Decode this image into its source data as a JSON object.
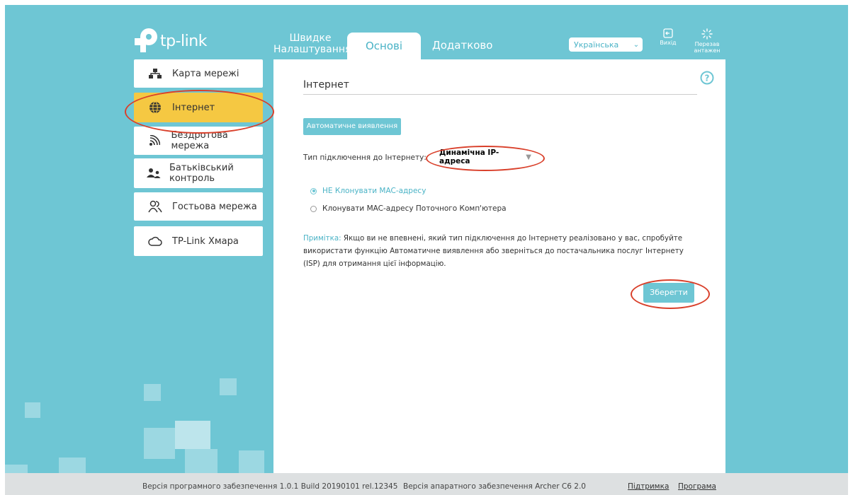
{
  "brand": {
    "logo_text": "tp-link"
  },
  "header": {
    "tabs": {
      "quick": "Швидке Налаштування",
      "basic": "Основі",
      "advanced": "Додатково"
    },
    "language": {
      "value": "Українська"
    },
    "logout_label": "Вихід",
    "reboot_label": "Перезав антажен"
  },
  "sidebar": {
    "items": [
      {
        "label": "Карта мережі",
        "icon": "network-map-icon"
      },
      {
        "label": "Інтернет",
        "icon": "globe-icon",
        "active": true
      },
      {
        "label": "Бездротова мережа",
        "icon": "wireless-icon"
      },
      {
        "label": "Батьківський контроль",
        "icon": "parental-control-icon"
      },
      {
        "label": "Гостьова мережа",
        "icon": "guest-icon"
      },
      {
        "label": "TP-Link Хмара",
        "icon": "cloud-icon"
      }
    ]
  },
  "main": {
    "title": "Інтернет",
    "auto_detect": "Автоматичне виявлення",
    "conn_type_label": "Тип підключення до Інтернету:",
    "conn_type_value": "Динамічна IP-адреса",
    "mac_options": [
      {
        "label": "НЕ Клонувати MAC-адресу",
        "selected": true
      },
      {
        "label": "Клонувати MAC-адресу Поточного Комп'ютера",
        "selected": false
      }
    ],
    "note_label": "Примітка:",
    "note_text": " Якщо ви не впевнені, який тип підключення до Інтернету реалізовано у вас, спробуйте використати функцію Автоматичне виявлення або зверніться до постачальника послуг Інтернету (ISP) для отримання цієї інформацію.",
    "save": "Зберегти"
  },
  "footer": {
    "firmware": "Версія програмного забезпечення 1.0.1 Build 20190101 rel.12345",
    "hardware": "Версія апаратного забезпечення Archer C6 2.0",
    "support": "Підтримка",
    "app": "Програма"
  },
  "colors": {
    "accent": "#6ec6d4",
    "active": "#f5c842",
    "highlight": "#d9402b"
  }
}
